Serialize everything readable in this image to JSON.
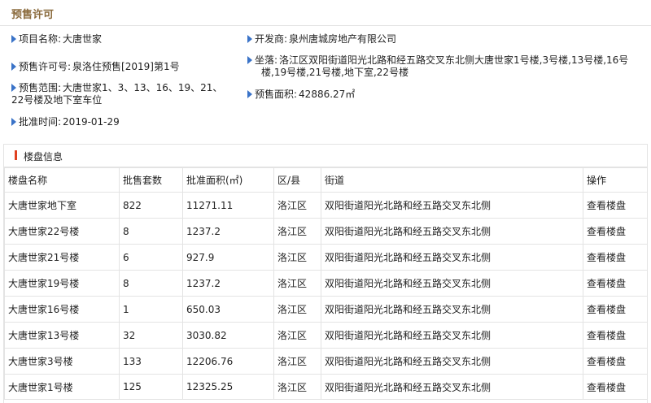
{
  "section_title": "预售许可",
  "info": {
    "project_name": {
      "label": "项目名称:",
      "value": "大唐世家"
    },
    "developer": {
      "label": "开发商:",
      "value": "泉州唐城房地产有限公司"
    },
    "permit_no": {
      "label": "预售许可号:",
      "value": "泉洛住预售[2019]第1号"
    },
    "location": {
      "label": "坐落:",
      "value_line1": "洛江区双阳街道阳光北路和经五路交叉东北侧大唐世家1号楼,3号楼,13号楼,16号",
      "value_line2": "楼,19号楼,21号楼,地下室,22号楼"
    },
    "scope": {
      "label": "预售范围:",
      "value_line1": "大唐世家1、3、13、16、19、21、",
      "value_line2": "22号楼及地下室车位"
    },
    "area": {
      "label": "预售面积:",
      "value": "42886.27㎡"
    },
    "approval_time": {
      "label": "批准时间:",
      "value": "2019-01-29"
    }
  },
  "panel_title": "楼盘信息",
  "table": {
    "headers": [
      "楼盘名称",
      "批售套数",
      "批准面积(㎡)",
      "区/县",
      "街道",
      "操作"
    ],
    "rows": [
      {
        "name": "大唐世家地下室",
        "units": "822",
        "area": "11271.11",
        "district": "洛江区",
        "street": "双阳街道阳光北路和经五路交叉东北侧",
        "action": "查看楼盘"
      },
      {
        "name": "大唐世家22号楼",
        "units": "8",
        "area": "1237.2",
        "district": "洛江区",
        "street": "双阳街道阳光北路和经五路交叉东北侧",
        "action": "查看楼盘"
      },
      {
        "name": "大唐世家21号楼",
        "units": "6",
        "area": "927.9",
        "district": "洛江区",
        "street": "双阳街道阳光北路和经五路交叉东北侧",
        "action": "查看楼盘"
      },
      {
        "name": "大唐世家19号楼",
        "units": "8",
        "area": "1237.2",
        "district": "洛江区",
        "street": "双阳街道阳光北路和经五路交叉东北侧",
        "action": "查看楼盘"
      },
      {
        "name": "大唐世家16号楼",
        "units": "1",
        "area": "650.03",
        "district": "洛江区",
        "street": "双阳街道阳光北路和经五路交叉东北侧",
        "action": "查看楼盘"
      },
      {
        "name": "大唐世家13号楼",
        "units": "32",
        "area": "3030.82",
        "district": "洛江区",
        "street": "双阳街道阳光北路和经五路交叉东北侧",
        "action": "查看楼盘"
      },
      {
        "name": "大唐世家3号楼",
        "units": "133",
        "area": "12206.76",
        "district": "洛江区",
        "street": "双阳街道阳光北路和经五路交叉东北侧",
        "action": "查看楼盘"
      },
      {
        "name": "大唐世家1号楼",
        "units": "125",
        "area": "12325.25",
        "district": "洛江区",
        "street": "双阳街道阳光北路和经五路交叉东北侧",
        "action": "查看楼盘"
      }
    ]
  }
}
